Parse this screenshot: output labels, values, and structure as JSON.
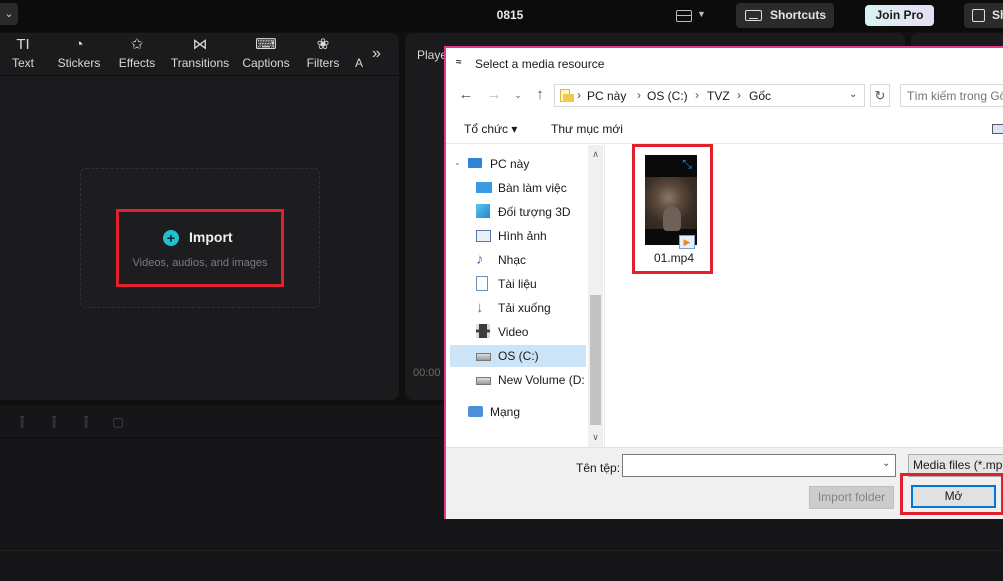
{
  "app": {
    "project_title": "0815",
    "shortcuts_label": "Shortcuts",
    "join_pro_label": "Join Pro",
    "share_label": "Sh"
  },
  "toolbar": {
    "items": [
      {
        "label": "Text",
        "icon": "text-icon",
        "glyph": "TI"
      },
      {
        "label": "Stickers",
        "icon": "sticker-icon",
        "glyph": "◔"
      },
      {
        "label": "Effects",
        "icon": "effects-icon",
        "glyph": "✩"
      },
      {
        "label": "Transitions",
        "icon": "transition-icon",
        "glyph": "⋈"
      },
      {
        "label": "Captions",
        "icon": "captions-icon",
        "glyph": "⌨"
      },
      {
        "label": "Filters",
        "icon": "filters-icon",
        "glyph": "❀"
      },
      {
        "label": "A",
        "icon": "adjust-icon",
        "glyph": ""
      }
    ],
    "more_glyph": "»"
  },
  "media": {
    "import_label": "Import",
    "import_sub": "Videos, audios, and images"
  },
  "player": {
    "title": "Playe",
    "time": "00:00"
  },
  "dialog": {
    "title": "Select a media resource",
    "breadcrumb": [
      "PC này",
      "OS (C:)",
      "TVZ",
      "Gốc"
    ],
    "search_placeholder": "Tìm kiếm trong Gốc",
    "organize_label": "Tổ chức ▾",
    "new_folder_label": "Thư mục mới",
    "nav_items": [
      {
        "label": "PC này",
        "icon": "pc-icon",
        "level": 0,
        "selected": false
      },
      {
        "label": "Bàn làm việc",
        "icon": "desktop-icon",
        "level": 1,
        "selected": false
      },
      {
        "label": "Đối tượng 3D",
        "icon": "3d-objects-icon",
        "level": 1,
        "selected": false
      },
      {
        "label": "Hình ảnh",
        "icon": "pictures-icon",
        "level": 1,
        "selected": false
      },
      {
        "label": "Nhạc",
        "icon": "music-icon",
        "level": 1,
        "selected": false
      },
      {
        "label": "Tài liệu",
        "icon": "documents-icon",
        "level": 1,
        "selected": false
      },
      {
        "label": "Tải xuống",
        "icon": "downloads-icon",
        "level": 1,
        "selected": false
      },
      {
        "label": "Video",
        "icon": "videos-icon",
        "level": 1,
        "selected": false
      },
      {
        "label": "OS (C:)",
        "icon": "drive-icon",
        "level": 1,
        "selected": true
      },
      {
        "label": "New Volume (D:",
        "icon": "drive-icon",
        "level": 1,
        "selected": false
      },
      {
        "label": "Mạng",
        "icon": "network-icon",
        "level": 0,
        "selected": false
      }
    ],
    "files": [
      {
        "name": "01.mp4",
        "icon": "video-file-icon"
      }
    ],
    "file_name_label": "Tên tệp:",
    "file_name_value": "",
    "filter_label": "Media files (*.mp",
    "import_folder_label": "Import folder",
    "open_label": "Mở"
  },
  "colors": {
    "accent": "#21c0d0",
    "highlight_red": "#e0202a",
    "dialog_border": "#e53a8c",
    "selection": "#cce4f7",
    "open_button_border": "#0078d7"
  }
}
